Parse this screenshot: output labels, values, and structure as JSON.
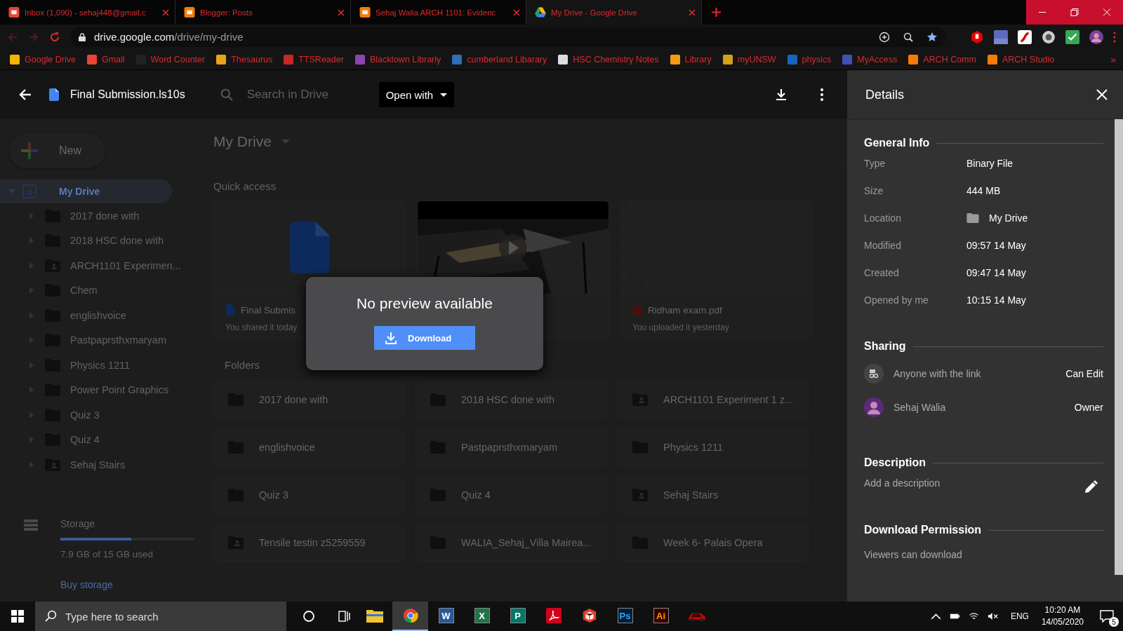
{
  "browser": {
    "tabs": [
      {
        "title": "Inbox (1,090) - sehaj448@gmail.c",
        "kind": "mail",
        "selected": false
      },
      {
        "title": "Blogger: Posts",
        "kind": "blog",
        "selected": false
      },
      {
        "title": "Sehaj Walia ARCH 1101: Evidenc",
        "kind": "blog",
        "selected": false
      },
      {
        "title": "My Drive - Google Drive",
        "kind": "drive",
        "selected": true
      }
    ],
    "url_host": "drive.google.com",
    "url_path": "/drive/my-drive",
    "bookmarks": [
      {
        "label": "Google Drive",
        "color": "#f4b400"
      },
      {
        "label": "Gmail",
        "color": "#ea4335"
      },
      {
        "label": "Word Counter",
        "color": "#222222"
      },
      {
        "label": "Thesaurus",
        "color": "#e8a317"
      },
      {
        "label": "TTSReader",
        "color": "#c62828"
      },
      {
        "label": "Blacktown Librariy",
        "color": "#8e44ad"
      },
      {
        "label": "cumberland Libarary",
        "color": "#2e6fb5"
      },
      {
        "label": "HSC Chemistry Notes",
        "color": "#dddddd"
      },
      {
        "label": "Library",
        "color": "#f39c12"
      },
      {
        "label": "myUNSW",
        "color": "#d4a017"
      },
      {
        "label": "physics",
        "color": "#1565c0"
      },
      {
        "label": "MyAccess",
        "color": "#3f51b5"
      },
      {
        "label": "ARCH Comm",
        "color": "#f57c00"
      },
      {
        "label": "ARCH Studio",
        "color": "#f57c00"
      }
    ],
    "bookmarks_more": "»"
  },
  "drive": {
    "file_name": "Final Submission.ls10s",
    "search": {
      "placeholder": "Search in Drive"
    },
    "open_with": "Open with",
    "sidebar": {
      "new_button": "New",
      "root": {
        "label": "My Drive",
        "selected": true,
        "expanded": true,
        "children": [
          {
            "label": "2017 done with",
            "kind": "folder",
            "expanded": false
          },
          {
            "label": "2018 HSC done with",
            "kind": "folder",
            "expanded": false
          },
          {
            "label": "ARCH1101 Experimen...",
            "kind": "shared",
            "expanded": false
          },
          {
            "label": "Chem",
            "kind": "folder",
            "expanded": false
          },
          {
            "label": "englishvoice",
            "kind": "folder",
            "expanded": false
          },
          {
            "label": "Pastpaprsthxmaryam",
            "kind": "folder",
            "expanded": false
          },
          {
            "label": "Physics 1211",
            "kind": "folder",
            "expanded": false
          },
          {
            "label": "Power Point Graphics",
            "kind": "folder",
            "expanded": false
          },
          {
            "label": "Quiz 3",
            "kind": "folder",
            "expanded": false
          },
          {
            "label": "Quiz 4",
            "kind": "folder",
            "expanded": false
          },
          {
            "label": "Sehaj Stairs",
            "kind": "shared",
            "expanded": false
          }
        ]
      },
      "storage": {
        "label": "Storage",
        "level": 0.53,
        "usage": "7.9 GB of 15 GB used",
        "buy": "Buy storage"
      }
    },
    "main": {
      "title": "My Drive",
      "quick_access": {
        "label": "Quick access",
        "cards": [
          {
            "kind": "doc",
            "name": "Final Submis",
            "note": "You shared it today"
          },
          {
            "kind": "video"
          },
          {
            "kind": "pdf",
            "name": "Ridham exam.pdf",
            "note": "You uploaded it yesterday"
          }
        ]
      },
      "folders": {
        "label": "Folders",
        "items": [
          {
            "name": "2017 done with",
            "kind": "folder"
          },
          {
            "name": "2018 HSC done with",
            "kind": "folder"
          },
          {
            "name": "ARCH1101 Experiment 1 z...",
            "kind": "shared"
          },
          {
            "name": "englishvoice",
            "kind": "folder"
          },
          {
            "name": "Pastpaprsthxmaryam",
            "kind": "folder"
          },
          {
            "name": "Physics 1211",
            "kind": "folder"
          },
          {
            "name": "Quiz 3",
            "kind": "folder"
          },
          {
            "name": "Quiz 4",
            "kind": "folder"
          },
          {
            "name": "Sehaj Stairs",
            "kind": "shared"
          },
          {
            "name": "Tensile testin z5259559",
            "kind": "shared"
          },
          {
            "name": "WALIA_Sehaj_Villa Mairea...",
            "kind": "folder"
          },
          {
            "name": "Week 6- Palais Opera",
            "kind": "folder"
          }
        ]
      }
    },
    "dialog": {
      "message": "No preview available",
      "button": "Download"
    }
  },
  "details": {
    "title": "Details",
    "general": {
      "heading": "General Info",
      "rows": [
        {
          "label": "Type",
          "value": "Binary File"
        },
        {
          "label": "Size",
          "value": "444 MB"
        },
        {
          "label": "Location",
          "value": "My Drive",
          "kind": "folder"
        },
        {
          "label": "Modified",
          "value": "09:57 14 May"
        },
        {
          "label": "Created",
          "value": "09:47 14 May"
        },
        {
          "label": "Opened by me",
          "value": "10:15 14 May"
        }
      ]
    },
    "sharing": {
      "heading": "Sharing",
      "rows": [
        {
          "name": "Anyone with the link",
          "role": "Can Edit",
          "kind": "link"
        },
        {
          "name": "Sehaj Walia",
          "role": "Owner",
          "kind": "user"
        }
      ]
    },
    "description": {
      "heading": "Description",
      "placeholder": "Add a description"
    },
    "permission": {
      "heading": "Download Permission",
      "text": "Viewers can download"
    }
  },
  "taskbar": {
    "search": {
      "placeholder": "Type here to search"
    },
    "apps": [
      {
        "kind": "explorer",
        "selected": false
      },
      {
        "kind": "chrome",
        "selected": true
      },
      {
        "kind": "word",
        "glyph": "W",
        "selected": false
      },
      {
        "kind": "excel",
        "glyph": "X",
        "selected": false
      },
      {
        "kind": "publisher",
        "glyph": "P",
        "selected": false
      },
      {
        "kind": "acrobat",
        "selected": false
      },
      {
        "kind": "sketchup",
        "selected": false
      },
      {
        "kind": "photoshop",
        "glyph": "Ps",
        "selected": false
      },
      {
        "kind": "illustrator",
        "glyph": "Ai",
        "selected": false
      },
      {
        "kind": "game",
        "selected": false
      }
    ],
    "language": "ENG",
    "time": "10:20 AM",
    "date": "14/05/2020",
    "notifications": "5"
  }
}
